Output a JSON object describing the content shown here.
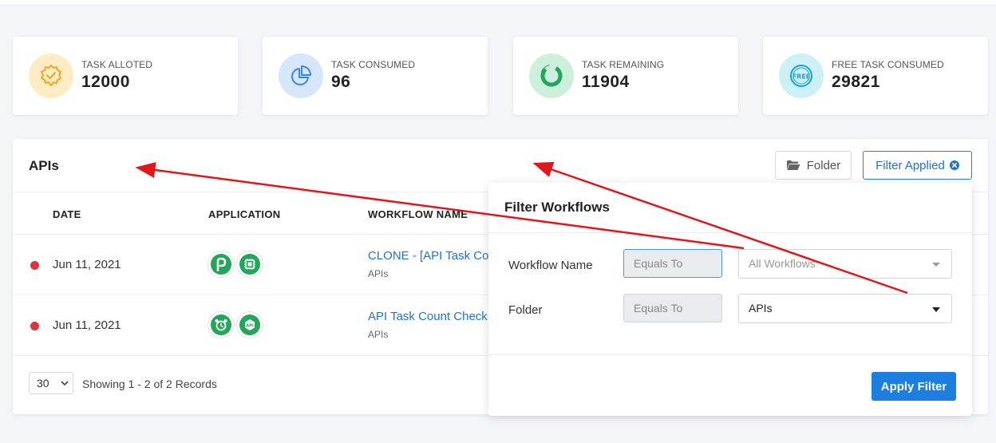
{
  "stats": [
    {
      "label": "TASK ALLOTED",
      "value": "12000",
      "icon": "badge-check-icon",
      "bg": "#fdecc4",
      "color": "#f0a722"
    },
    {
      "label": "TASK CONSUMED",
      "value": "96",
      "icon": "pie-chart-icon",
      "bg": "#d6e6fb",
      "color": "#3b86e0"
    },
    {
      "label": "TASK REMAINING",
      "value": "11904",
      "icon": "donut-chart-icon",
      "bg": "#cdf0dc",
      "color": "#1fa85c"
    },
    {
      "label": "FREE TASK CONSUMED",
      "value": "29821",
      "icon": "free-badge-icon",
      "bg": "#cdeff6",
      "color": "#1aa6c4"
    }
  ],
  "panel": {
    "title": "APIs",
    "folder_button": "Folder",
    "filter_button": "Filter Applied"
  },
  "table": {
    "columns": [
      "DATE",
      "APPLICATION",
      "WORKFLOW NAME"
    ],
    "rows": [
      {
        "date": "Jun 11, 2021",
        "workflow": "CLONE - [API Task Cou",
        "folder": "APIs",
        "status_color": "#d9363e",
        "apps": [
          "pabbly-p-icon",
          "api-chip-icon"
        ]
      },
      {
        "date": "Jun 11, 2021",
        "workflow": "API Task Count Check",
        "folder": "APIs",
        "status_color": "#d9363e",
        "apps": [
          "alarm-clock-icon",
          "api-badge-icon"
        ]
      }
    ]
  },
  "footer": {
    "page_size": "30",
    "records_text": "Showing 1 - 2 of 2 Records"
  },
  "filter_popover": {
    "title": "Filter Workflows",
    "workflow_label": "Workflow Name",
    "workflow_operator": "Equals To",
    "workflow_placeholder": "All Workflows",
    "folder_label": "Folder",
    "folder_operator": "Equals To",
    "folder_value": "APIs",
    "apply_button": "Apply Filter"
  },
  "colors": {
    "accent": "#1f74c7",
    "apply_button": "#1c7fe0",
    "annotation_arrow": "#e0161b",
    "app_icon_green": "#23a55a"
  }
}
